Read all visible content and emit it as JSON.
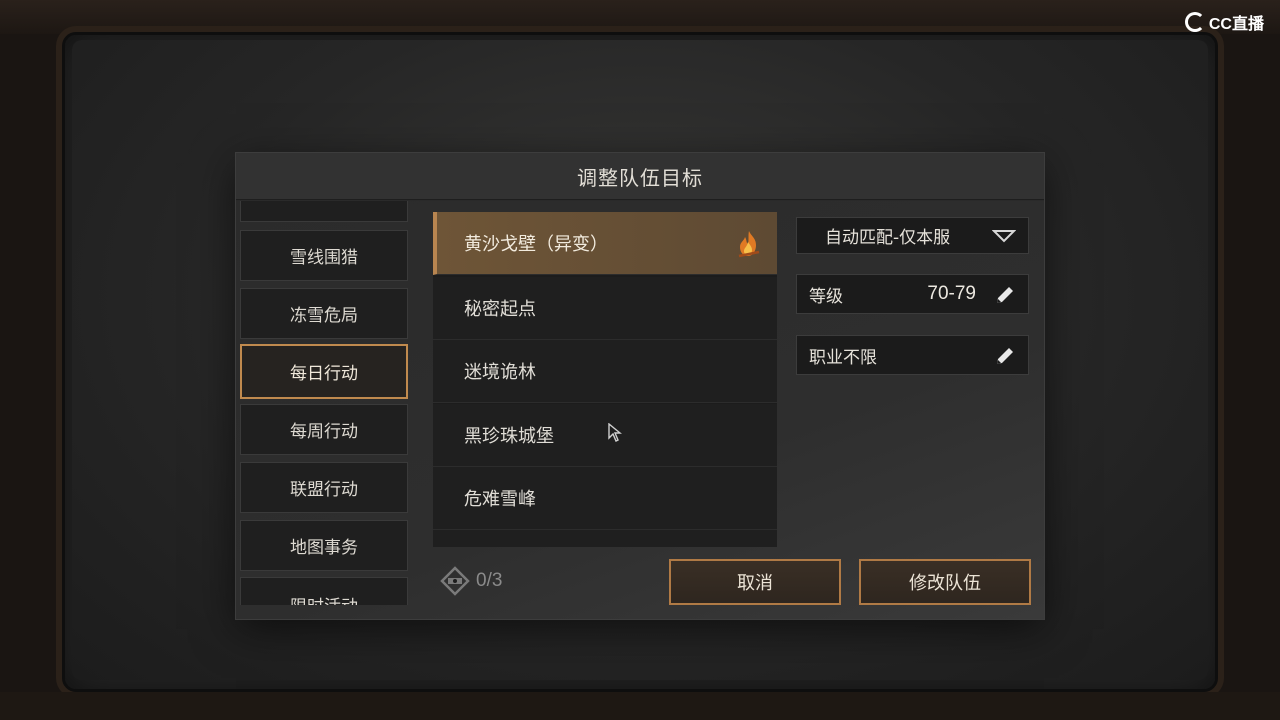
{
  "watermark": {
    "text": "CC直播"
  },
  "dialog": {
    "title": "调整队伍目标",
    "categories": [
      {
        "label": "雪线围猎",
        "active": false
      },
      {
        "label": "冻雪危局",
        "active": false
      },
      {
        "label": "每日行动",
        "active": true
      },
      {
        "label": "每周行动",
        "active": false
      },
      {
        "label": "联盟行动",
        "active": false
      },
      {
        "label": "地图事务",
        "active": false
      },
      {
        "label": "限时活动",
        "active": false
      }
    ],
    "dungeons": [
      {
        "label": "黄沙戈壁（异变）",
        "selected": true,
        "icon": "fire-icon"
      },
      {
        "label": "秘密起点",
        "selected": false
      },
      {
        "label": "迷境诡林",
        "selected": false
      },
      {
        "label": "黑珍珠城堡",
        "selected": false
      },
      {
        "label": "危难雪峰",
        "selected": false
      }
    ],
    "match_dropdown": {
      "value": "自动匹配-仅本服",
      "icon": "chevron-down-icon"
    },
    "level_field": {
      "label": "等级",
      "value": "70-79",
      "icon": "pencil-icon"
    },
    "class_field": {
      "label": "职业不限",
      "icon": "pencil-icon"
    },
    "member_count": {
      "value": "0/3",
      "icon": "team-icon"
    },
    "buttons": {
      "cancel": "取消",
      "modify": "修改队伍"
    }
  },
  "colors": {
    "accent": "#b07a45",
    "selected_row": "#6e5537"
  }
}
